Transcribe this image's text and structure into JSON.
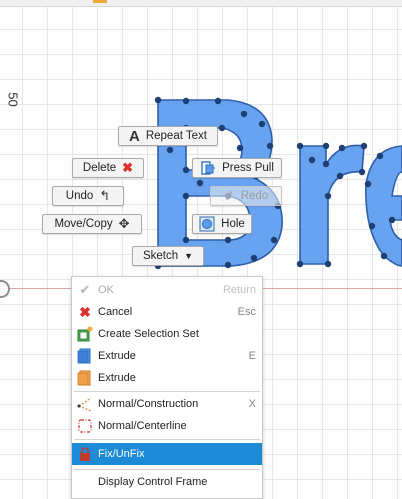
{
  "viewport": {
    "axis_label": "50"
  },
  "sketch_text": {
    "letters": "Bre",
    "fill_color": "#5b9bf1",
    "edge_color": "#2d5fa8"
  },
  "marking_menu": {
    "repeat_text": "Repeat Text",
    "delete": "Delete",
    "undo": "Undo",
    "move_copy": "Move/Copy",
    "press_pull": "Press Pull",
    "redo": "Redo",
    "hole": "Hole",
    "sketch": "Sketch"
  },
  "context_menu": {
    "items": [
      {
        "label": "OK",
        "shortcut": "Return",
        "icon": "check-icon",
        "disabled": true
      },
      {
        "label": "Cancel",
        "shortcut": "Esc",
        "icon": "red-x-icon",
        "disabled": false
      },
      {
        "label": "Create Selection Set",
        "shortcut": "",
        "icon": "selection-set-icon",
        "disabled": false
      },
      {
        "label": "Extrude",
        "shortcut": "E",
        "icon": "extrude-blue-icon",
        "disabled": false
      },
      {
        "label": "Extrude",
        "shortcut": "",
        "icon": "extrude-orange-icon",
        "disabled": false
      },
      {
        "label": "Normal/Construction",
        "shortcut": "X",
        "icon": "construction-line-icon",
        "disabled": false
      },
      {
        "label": "Normal/Centerline",
        "shortcut": "",
        "icon": "centerline-icon",
        "disabled": false
      },
      {
        "label": "Fix/UnFix",
        "shortcut": "",
        "icon": "lock-icon",
        "disabled": false,
        "selected": true
      },
      {
        "label": "Display Control Frame",
        "shortcut": "",
        "icon": "",
        "disabled": false
      }
    ]
  }
}
